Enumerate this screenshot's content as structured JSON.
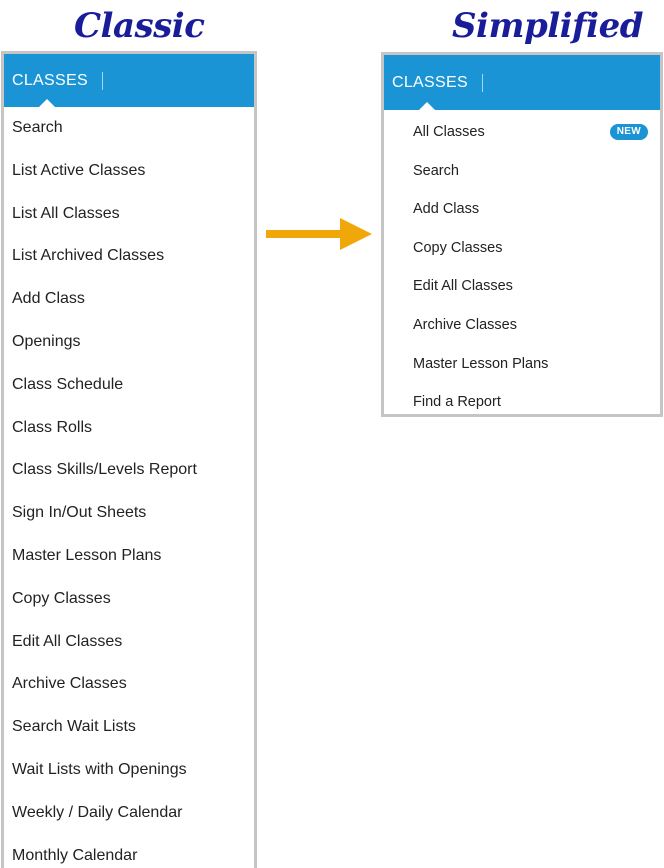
{
  "captions": {
    "classic": "Classic",
    "simplified": "Simplified"
  },
  "classic_menu": {
    "header": "CLASSES",
    "items": [
      "Search",
      "List Active Classes",
      "List All Classes",
      "List Archived Classes",
      "Add Class",
      "Openings",
      "Class Schedule",
      "Class Rolls",
      "Class Skills/Levels Report",
      "Sign In/Out Sheets",
      "Master Lesson Plans",
      "Copy Classes",
      "Edit All Classes",
      "Archive Classes",
      "Search Wait Lists",
      "Wait Lists with Openings",
      "Weekly / Daily Calendar",
      "Monthly Calendar"
    ]
  },
  "simplified_menu": {
    "header": "CLASSES",
    "badge": "NEW",
    "items": [
      "All Classes",
      "Search",
      "Add Class",
      "Copy Classes",
      "Edit All Classes",
      "Archive Classes",
      "Master Lesson Plans",
      "Find a Report"
    ]
  },
  "colors": {
    "header_blue": "#1b94d6",
    "caption_navy": "#1a1d9a",
    "arrow_orange": "#f0a70a",
    "panel_border": "#c5c5c5"
  },
  "icons": {
    "arrow": "right-arrow-icon"
  }
}
